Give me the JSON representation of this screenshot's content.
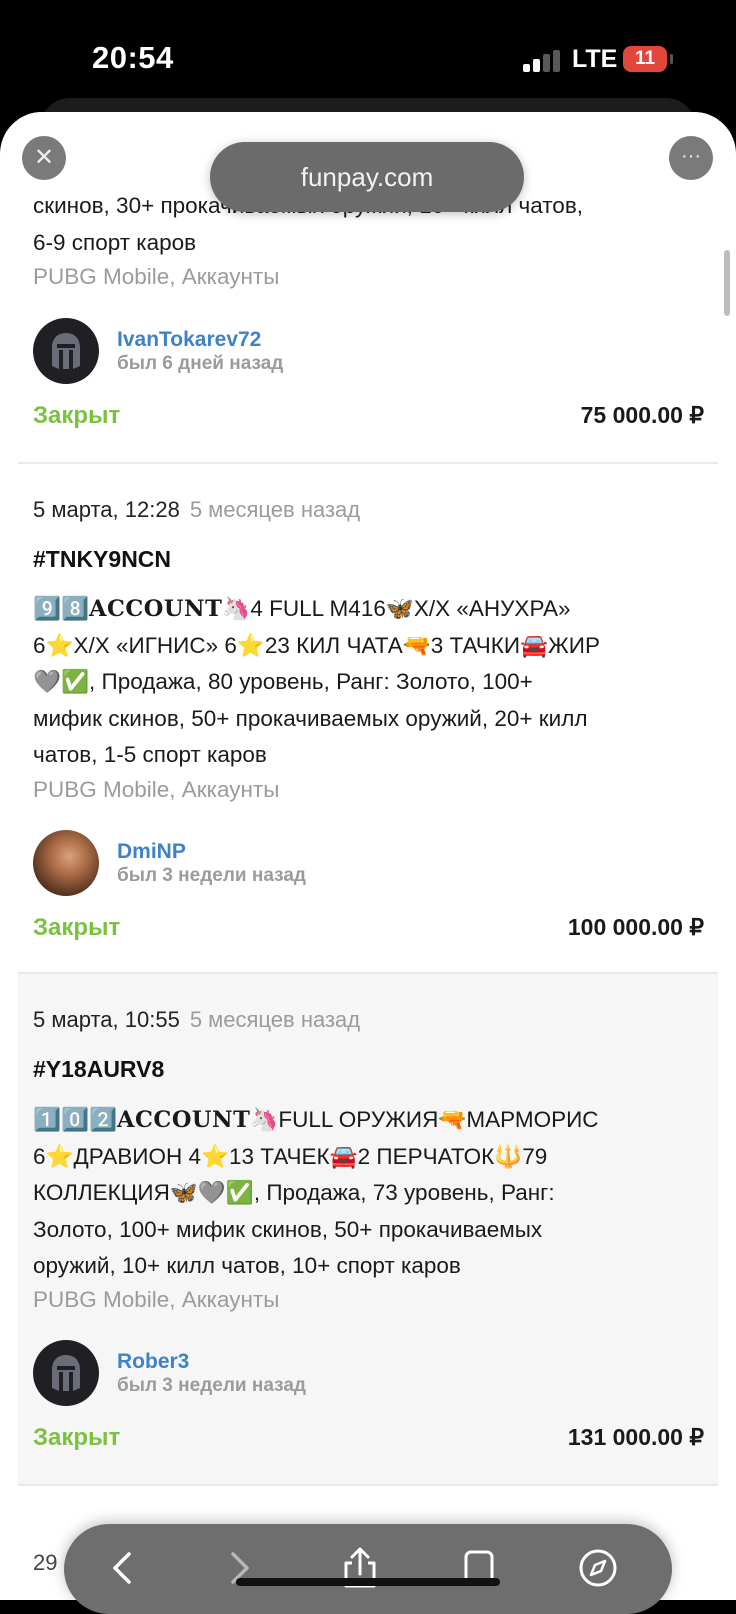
{
  "status": {
    "time": "20:54",
    "network": "LTE",
    "battery": "11"
  },
  "browser": {
    "url": "funpay.com",
    "close_icon": "close-icon",
    "more_icon": "more-icon",
    "toolbar": [
      "back-icon",
      "forward-icon",
      "share-icon",
      "tabs-icon",
      "compass-icon"
    ]
  },
  "colors": {
    "closed": "#7cc242",
    "username": "#3f82c7",
    "muted": "#9b9b9b"
  },
  "first": {
    "desc_line1": "скинов, 30+ прокачиваемых оружий, 10+ килл чатов,",
    "desc_line2": "6-9 спорт каров",
    "game": "PUBG Mobile, Аккаунты",
    "user": "IvanTokarev72",
    "seen": "был 6 дней назад",
    "status": "Закрыт",
    "price": "75 000.00 ₽"
  },
  "orders": [
    {
      "date": "5 марта, 12:28",
      "ago": "5 месяцев назад",
      "code": "#TNKY9NCN",
      "desc_l1_a": "9️⃣8️⃣",
      "desc_l1_b": "ACCOUNT",
      "desc_l1_c": "🦄4 FULL M416🦋Х/Х «АНУХРА»",
      "desc_l2": "6⭐Х/Х «ИГНИС» 6⭐23 КИЛ ЧАТА🔫3 ТАЧКИ🚘ЖИР",
      "desc_l3": "🩶✅, Продажа, 80 уровень, Ранг: Золото, 100+",
      "desc_l4": "мифик скинов, 50+ прокачиваемых оружий, 20+ килл",
      "desc_l5": "чатов, 1-5 спорт каров",
      "game": "PUBG Mobile, Аккаунты",
      "user": "DmiNP",
      "seen": "был 3 недели назад",
      "status": "Закрыт",
      "price": "100 000.00 ₽"
    },
    {
      "date": "5 марта, 10:55",
      "ago": "5 месяцев назад",
      "code": "#Y18AURV8",
      "desc_l1_a": "1️⃣0️⃣2️⃣",
      "desc_l1_b": "ACCOUNT",
      "desc_l1_c": "🦄FULL ОРУЖИЯ🔫МАРМОРИС",
      "desc_l2": "6⭐ДРАВИОН 4⭐13 ТАЧЕК🚘2 ПЕРЧАТОК🔱79",
      "desc_l3": "КОЛЛЕКЦИЯ🦋🩶✅, Продажа, 73 уровень, Ранг:",
      "desc_l4": "Золото, 100+ мифик скинов, 50+ прокачиваемых",
      "desc_l5": "оружий, 10+ килл чатов, 10+ спорт каров",
      "game": "PUBG Mobile, Аккаунты",
      "user": "Rober3",
      "seen": "был 3 недели назад",
      "status": "Закрыт",
      "price": "131 000.00 ₽"
    }
  ],
  "peek": "29"
}
